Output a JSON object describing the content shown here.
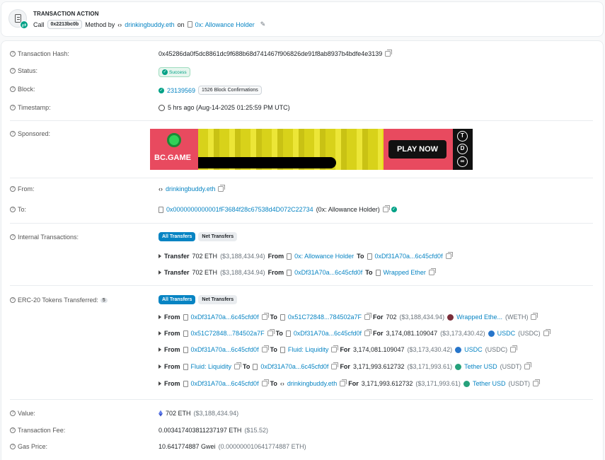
{
  "action": {
    "title": "TRANSACTION ACTION",
    "call": "Call",
    "method_id": "0x2213bc0b",
    "method_by": "Method by",
    "by": "drinkingbuddy.eth",
    "on": "on",
    "target": "0x: Allowance Holder"
  },
  "hash": {
    "label": "Transaction Hash:",
    "value": "0x45286da0f5dc8861dc9f688b68d741467f906826de91f8ab8937b4bdfe4e3139"
  },
  "status": {
    "label": "Status:",
    "value": "Success"
  },
  "block": {
    "label": "Block:",
    "number": "23139569",
    "confirmations": "1526 Block Confirmations"
  },
  "timestamp": {
    "label": "Timestamp:",
    "value": "5 hrs ago (Aug-14-2025 01:25:59 PM UTC)"
  },
  "sponsored": {
    "label": "Sponsored:",
    "brand": "BC.GAME",
    "cta": "PLAY NOW",
    "coins": [
      "T",
      "D",
      "∞"
    ]
  },
  "from": {
    "label": "From:",
    "value": "drinkingbuddy.eth"
  },
  "to": {
    "label": "To:",
    "address": "0x0000000000001fF3684f28c67538d4D072C22734",
    "name": "(0x: Allowance Holder)"
  },
  "internal": {
    "label": "Internal Transactions:",
    "tab_all": "All Transfers",
    "tab_net": "Net Transfers",
    "rows": [
      {
        "text": "Transfer",
        "amount": "702 ETH",
        "usd": "($3,188,434.94)",
        "from_label": "From",
        "from": "0x: Allowance Holder",
        "to_label": "To",
        "to": "0xDf31A70a...6c45cfd0f"
      },
      {
        "text": "Transfer",
        "amount": "702 ETH",
        "usd": "($3,188,434.94)",
        "from_label": "From",
        "from": "0xDf31A70a...6c45cfd0f",
        "to_label": "To",
        "to": "Wrapped Ether"
      }
    ]
  },
  "erc20": {
    "label": "ERC-20 Tokens Transferred:",
    "count": "5",
    "tab_all": "All Transfers",
    "tab_net": "Net Transfers",
    "rows": [
      {
        "from": "0xDf31A70a...6c45cfd0f",
        "to": "0x51C72848...784502a7F",
        "amount": "702",
        "usd": "($3,188,434.94)",
        "token": "Wrapped Ethe...",
        "symbol": "(WETH)",
        "color": "#7b2e3a"
      },
      {
        "from": "0x51C72848...784502a7F",
        "to": "0xDf31A70a...6c45cfd0f",
        "amount": "3,174,081.109047",
        "usd": "($3,173,430.42)",
        "token": "USDC",
        "symbol": "(USDC)",
        "color": "#2775ca"
      },
      {
        "from": "0xDf31A70a...6c45cfd0f",
        "to": "Fluid: Liquidity",
        "amount": "3,174,081.109047",
        "usd": "($3,173,430.42)",
        "token": "USDC",
        "symbol": "(USDC)",
        "color": "#2775ca"
      },
      {
        "from": "Fluid: Liquidity",
        "to": "0xDf31A70a...6c45cfd0f",
        "amount": "3,171,993.612732",
        "usd": "($3,171,993.61)",
        "token": "Tether USD",
        "symbol": "(USDT)",
        "color": "#26a17b"
      },
      {
        "from": "0xDf31A70a...6c45cfd0f",
        "to": "drinkingbuddy.eth",
        "amount": "3,171,993.612732",
        "usd": "($3,171,993.61)",
        "token": "Tether USD",
        "symbol": "(USDT)",
        "color": "#26a17b"
      }
    ],
    "from_label": "From",
    "to_label": "To",
    "for_label": "For"
  },
  "value": {
    "label": "Value:",
    "amount": "702 ETH",
    "usd": "($3,188,434.94)"
  },
  "fee": {
    "label": "Transaction Fee:",
    "amount": "0.003417403811237197 ETH",
    "usd": "($15.52)"
  },
  "gas": {
    "label": "Gas Price:",
    "amount": "10.641774887 Gwei",
    "eth": "(0.000000010641774887 ETH)"
  }
}
